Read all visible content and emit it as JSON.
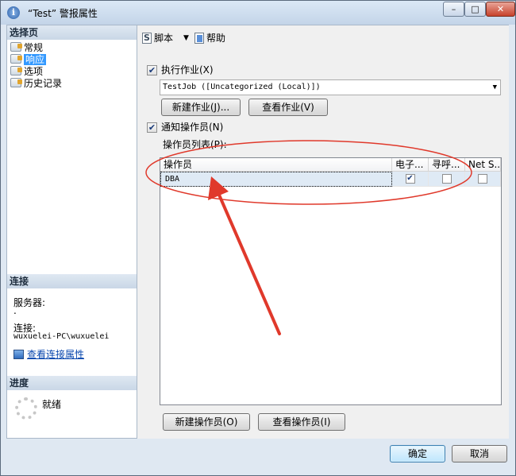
{
  "window": {
    "title": "“Test” 警报属性"
  },
  "left": {
    "select_page_header": "选择页",
    "nav_items": [
      {
        "label": "常规"
      },
      {
        "label": "响应"
      },
      {
        "label": "选项"
      },
      {
        "label": "历史记录"
      }
    ],
    "connection_header": "连接",
    "server_label": "服务器:",
    "server_value": ".",
    "connection_label": "连接:",
    "connection_value": "wuxuelei-PC\\wuxuelei",
    "view_connection_link": "查看连接属性",
    "progress_header": "进度",
    "progress_status": "就绪"
  },
  "toolbar": {
    "script_label": "脚本",
    "help_label": "帮助"
  },
  "main": {
    "execute_job_label": "执行作业(X)",
    "execute_job_checked": true,
    "job_combo_value": "TestJob ([Uncategorized (Local)])",
    "new_job_button": "新建作业(J)...",
    "view_job_button": "查看作业(V)",
    "notify_operators_label": "通知操作员(N)",
    "notify_operators_checked": true,
    "operator_list_label": "操作员列表(P):",
    "grid": {
      "columns": [
        "操作员",
        "电子...",
        "寻呼...",
        "Net S..."
      ],
      "rows": [
        {
          "operator": "DBA",
          "email": true,
          "pager": false,
          "net_send": false
        }
      ]
    },
    "new_operator_button": "新建操作员(O)",
    "view_operator_button": "查看操作员(I)"
  },
  "footer": {
    "ok_button": "确定",
    "cancel_button": "取消"
  },
  "colors": {
    "annotation": "#e0392b",
    "selection": "#3399ff",
    "link": "#0645ad"
  }
}
